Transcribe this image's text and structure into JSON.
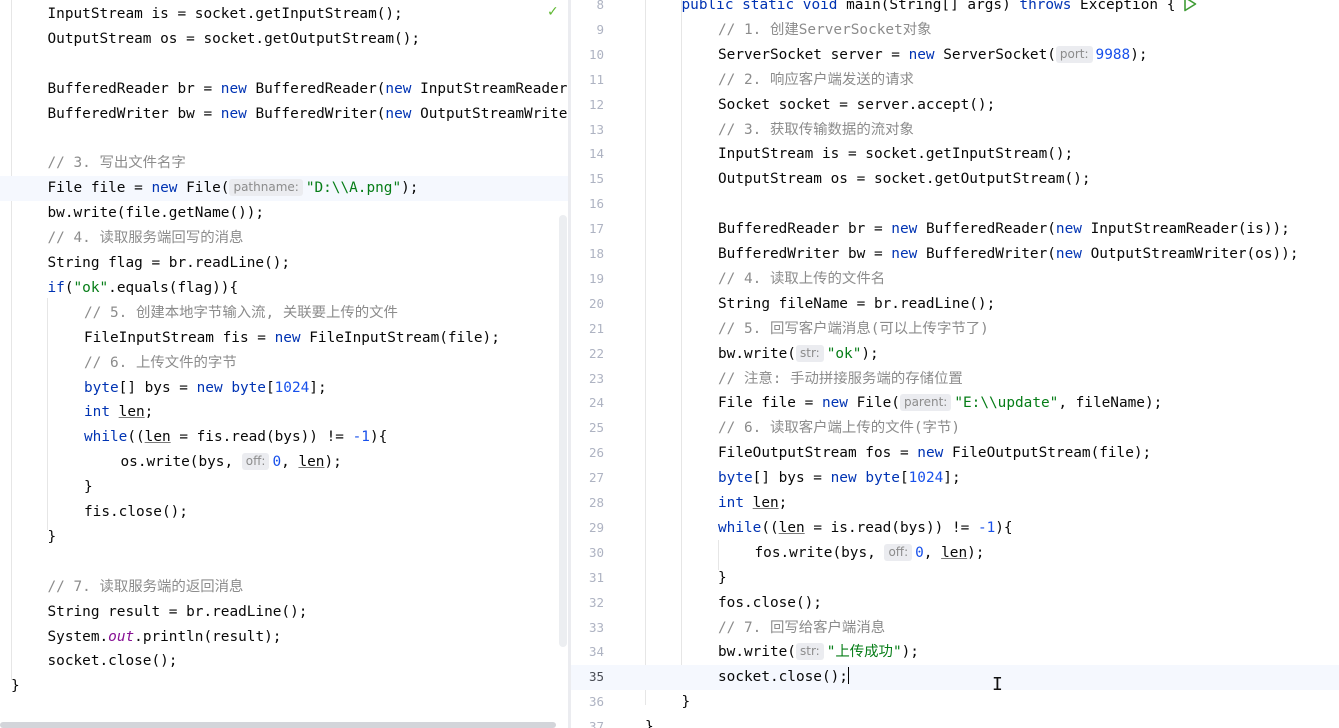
{
  "left_lines": [
    {
      "row": 0,
      "indent": 1,
      "current": false,
      "tokens": [
        {
          "t": "InputStream is = socket.getInputStream();"
        }
      ]
    },
    {
      "row": 1,
      "indent": 1,
      "current": false,
      "tokens": [
        {
          "t": "OutputStream os = socket.getOutputStream();"
        }
      ]
    },
    {
      "row": 3,
      "indent": 1,
      "current": false,
      "tokens": [
        {
          "t": "BufferedReader br = "
        },
        {
          "t": "new",
          "c": "kw"
        },
        {
          "t": " BufferedReader("
        },
        {
          "t": "new",
          "c": "kw"
        },
        {
          "t": " InputStreamReader(is));"
        }
      ]
    },
    {
      "row": 4,
      "indent": 1,
      "current": false,
      "tokens": [
        {
          "t": "BufferedWriter bw = "
        },
        {
          "t": "new",
          "c": "kw"
        },
        {
          "t": " BufferedWriter("
        },
        {
          "t": "new",
          "c": "kw"
        },
        {
          "t": " OutputStreamWriter(os));"
        }
      ]
    },
    {
      "row": 6,
      "indent": 1,
      "current": false,
      "tokens": [
        {
          "t": "// 3. 写出文件名字",
          "c": "cmt"
        }
      ]
    },
    {
      "row": 7,
      "indent": 1,
      "current": true,
      "tokens": [
        {
          "t": "File file = "
        },
        {
          "t": "new",
          "c": "kw"
        },
        {
          "t": " File("
        },
        {
          "t": "pathname:",
          "c": "hint"
        },
        {
          "t": "\"D:\\\\A.png\"",
          "c": "str"
        },
        {
          "t": ");"
        }
      ]
    },
    {
      "row": 8,
      "indent": 1,
      "current": false,
      "tokens": [
        {
          "t": "bw.write(file.getName());"
        }
      ]
    },
    {
      "row": 9,
      "indent": 1,
      "current": false,
      "tokens": [
        {
          "t": "// 4. 读取服务端回写的消息",
          "c": "cmt"
        }
      ]
    },
    {
      "row": 10,
      "indent": 1,
      "current": false,
      "tokens": [
        {
          "t": "String flag = br.readLine();"
        }
      ]
    },
    {
      "row": 11,
      "indent": 1,
      "current": false,
      "tokens": [
        {
          "t": "if",
          "c": "kw"
        },
        {
          "t": "("
        },
        {
          "t": "\"ok\"",
          "c": "str"
        },
        {
          "t": ".equals(flag)){"
        }
      ]
    },
    {
      "row": 12,
      "indent": 2,
      "current": false,
      "tokens": [
        {
          "t": "// 5. 创建本地字节输入流, 关联要上传的文件",
          "c": "cmt"
        }
      ]
    },
    {
      "row": 13,
      "indent": 2,
      "current": false,
      "tokens": [
        {
          "t": "FileInputStream fis = "
        },
        {
          "t": "new",
          "c": "kw"
        },
        {
          "t": " FileInputStream(file);"
        }
      ]
    },
    {
      "row": 14,
      "indent": 2,
      "current": false,
      "tokens": [
        {
          "t": "// 6. 上传文件的字节",
          "c": "cmt"
        }
      ]
    },
    {
      "row": 15,
      "indent": 2,
      "current": false,
      "tokens": [
        {
          "t": "byte",
          "c": "kw"
        },
        {
          "t": "[] bys = "
        },
        {
          "t": "new",
          "c": "kw"
        },
        {
          "t": " "
        },
        {
          "t": "byte",
          "c": "kw"
        },
        {
          "t": "["
        },
        {
          "t": "1024",
          "c": "num"
        },
        {
          "t": "];"
        }
      ]
    },
    {
      "row": 16,
      "indent": 2,
      "current": false,
      "tokens": [
        {
          "t": "int",
          "c": "kw"
        },
        {
          "t": " "
        },
        {
          "t": "len",
          "c": "ul"
        },
        {
          "t": ";"
        }
      ]
    },
    {
      "row": 17,
      "indent": 2,
      "current": false,
      "tokens": [
        {
          "t": "while",
          "c": "kw"
        },
        {
          "t": "(("
        },
        {
          "t": "len",
          "c": "ul"
        },
        {
          "t": " = fis.read(bys)) != "
        },
        {
          "t": "-1",
          "c": "num"
        },
        {
          "t": "){"
        }
      ]
    },
    {
      "row": 18,
      "indent": 3,
      "current": false,
      "tokens": [
        {
          "t": "os.write(bys, "
        },
        {
          "t": "off:",
          "c": "hint"
        },
        {
          "t": "0",
          "c": "num"
        },
        {
          "t": ", "
        },
        {
          "t": "len",
          "c": "ul"
        },
        {
          "t": ");"
        }
      ]
    },
    {
      "row": 19,
      "indent": 2,
      "current": false,
      "tokens": [
        {
          "t": "}"
        }
      ]
    },
    {
      "row": 20,
      "indent": 2,
      "current": false,
      "tokens": [
        {
          "t": "fis.close();"
        }
      ]
    },
    {
      "row": 21,
      "indent": 1,
      "current": false,
      "tokens": [
        {
          "t": "}"
        }
      ]
    },
    {
      "row": 23,
      "indent": 1,
      "current": false,
      "tokens": [
        {
          "t": "// 7. 读取服务端的返回消息",
          "c": "cmt"
        }
      ]
    },
    {
      "row": 24,
      "indent": 1,
      "current": false,
      "tokens": [
        {
          "t": "String result = br.readLine();"
        }
      ]
    },
    {
      "row": 25,
      "indent": 1,
      "current": false,
      "tokens": [
        {
          "t": "System."
        },
        {
          "t": "out",
          "c": "st"
        },
        {
          "t": ".println(result);"
        }
      ]
    },
    {
      "row": 26,
      "indent": 1,
      "current": false,
      "tokens": [
        {
          "t": "socket.close();"
        }
      ]
    },
    {
      "row": 27,
      "indent": 0,
      "current": false,
      "tokens": [
        {
          "t": "}"
        }
      ]
    }
  ],
  "right_lines": [
    {
      "n": "8",
      "indent": 1,
      "current": false,
      "tokens": [
        {
          "t": "public static void",
          "c": "kw"
        },
        {
          "t": " main(String[] args) "
        },
        {
          "t": "throws",
          "c": "kw"
        },
        {
          "t": " Exception {"
        }
      ]
    },
    {
      "n": "9",
      "indent": 2,
      "current": false,
      "tokens": [
        {
          "t": "// 1. 创建ServerSocket对象",
          "c": "cmt"
        }
      ]
    },
    {
      "n": "10",
      "indent": 2,
      "current": false,
      "tokens": [
        {
          "t": "ServerSocket server = "
        },
        {
          "t": "new",
          "c": "kw"
        },
        {
          "t": " ServerSocket("
        },
        {
          "t": "port:",
          "c": "hint"
        },
        {
          "t": "9988",
          "c": "num"
        },
        {
          "t": ");"
        }
      ]
    },
    {
      "n": "11",
      "indent": 2,
      "current": false,
      "tokens": [
        {
          "t": "// 2. 响应客户端发送的请求",
          "c": "cmt"
        }
      ]
    },
    {
      "n": "12",
      "indent": 2,
      "current": false,
      "tokens": [
        {
          "t": "Socket socket = server.accept();"
        }
      ]
    },
    {
      "n": "13",
      "indent": 2,
      "current": false,
      "tokens": [
        {
          "t": "// 3. 获取传输数据的流对象",
          "c": "cmt"
        }
      ]
    },
    {
      "n": "14",
      "indent": 2,
      "current": false,
      "tokens": [
        {
          "t": "InputStream is = socket.getInputStream();"
        }
      ]
    },
    {
      "n": "15",
      "indent": 2,
      "current": false,
      "tokens": [
        {
          "t": "OutputStream os = socket.getOutputStream();"
        }
      ]
    },
    {
      "n": "16",
      "indent": 2,
      "current": false,
      "tokens": []
    },
    {
      "n": "17",
      "indent": 2,
      "current": false,
      "tokens": [
        {
          "t": "BufferedReader br = "
        },
        {
          "t": "new",
          "c": "kw"
        },
        {
          "t": " BufferedReader("
        },
        {
          "t": "new",
          "c": "kw"
        },
        {
          "t": " InputStreamReader(is));"
        }
      ]
    },
    {
      "n": "18",
      "indent": 2,
      "current": false,
      "tokens": [
        {
          "t": "BufferedWriter bw = "
        },
        {
          "t": "new",
          "c": "kw"
        },
        {
          "t": " BufferedWriter("
        },
        {
          "t": "new",
          "c": "kw"
        },
        {
          "t": " OutputStreamWriter(os));"
        }
      ]
    },
    {
      "n": "19",
      "indent": 2,
      "current": false,
      "tokens": [
        {
          "t": "// 4. 读取上传的文件名",
          "c": "cmt"
        }
      ]
    },
    {
      "n": "20",
      "indent": 2,
      "current": false,
      "tokens": [
        {
          "t": "String fileName = br.readLine();"
        }
      ]
    },
    {
      "n": "21",
      "indent": 2,
      "current": false,
      "tokens": [
        {
          "t": "// 5. 回写客户端消息(可以上传字节了)",
          "c": "cmt"
        }
      ]
    },
    {
      "n": "22",
      "indent": 2,
      "current": false,
      "tokens": [
        {
          "t": "bw.write("
        },
        {
          "t": "str:",
          "c": "hint"
        },
        {
          "t": "\"ok\"",
          "c": "str"
        },
        {
          "t": ");"
        }
      ]
    },
    {
      "n": "23",
      "indent": 2,
      "current": false,
      "tokens": [
        {
          "t": "// 注意: 手动拼接服务端的存储位置",
          "c": "cmt"
        }
      ]
    },
    {
      "n": "24",
      "indent": 2,
      "current": false,
      "tokens": [
        {
          "t": "File file = "
        },
        {
          "t": "new",
          "c": "kw"
        },
        {
          "t": " File("
        },
        {
          "t": "parent:",
          "c": "hint"
        },
        {
          "t": "\"E:\\\\update\"",
          "c": "str"
        },
        {
          "t": ", fileName);"
        }
      ]
    },
    {
      "n": "25",
      "indent": 2,
      "current": false,
      "tokens": [
        {
          "t": "// 6. 读取客户端上传的文件(字节)",
          "c": "cmt"
        }
      ]
    },
    {
      "n": "26",
      "indent": 2,
      "current": false,
      "tokens": [
        {
          "t": "FileOutputStream fos = "
        },
        {
          "t": "new",
          "c": "kw"
        },
        {
          "t": " FileOutputStream(file);"
        }
      ]
    },
    {
      "n": "27",
      "indent": 2,
      "current": false,
      "tokens": [
        {
          "t": "byte",
          "c": "kw"
        },
        {
          "t": "[] bys = "
        },
        {
          "t": "new",
          "c": "kw"
        },
        {
          "t": " "
        },
        {
          "t": "byte",
          "c": "kw"
        },
        {
          "t": "["
        },
        {
          "t": "1024",
          "c": "num"
        },
        {
          "t": "];"
        }
      ]
    },
    {
      "n": "28",
      "indent": 2,
      "current": false,
      "tokens": [
        {
          "t": "int",
          "c": "kw"
        },
        {
          "t": " "
        },
        {
          "t": "len",
          "c": "ul"
        },
        {
          "t": ";"
        }
      ]
    },
    {
      "n": "29",
      "indent": 2,
      "current": false,
      "tokens": [
        {
          "t": "while",
          "c": "kw"
        },
        {
          "t": "(("
        },
        {
          "t": "len",
          "c": "ul"
        },
        {
          "t": " = is.read(bys)) != "
        },
        {
          "t": "-1",
          "c": "num"
        },
        {
          "t": "){"
        }
      ]
    },
    {
      "n": "30",
      "indent": 3,
      "current": false,
      "tokens": [
        {
          "t": "fos.write(bys, "
        },
        {
          "t": "off:",
          "c": "hint"
        },
        {
          "t": "0",
          "c": "num"
        },
        {
          "t": ", "
        },
        {
          "t": "len",
          "c": "ul"
        },
        {
          "t": ");"
        }
      ]
    },
    {
      "n": "31",
      "indent": 2,
      "current": false,
      "tokens": [
        {
          "t": "}"
        }
      ]
    },
    {
      "n": "32",
      "indent": 2,
      "current": false,
      "tokens": [
        {
          "t": "fos.close();"
        }
      ]
    },
    {
      "n": "33",
      "indent": 2,
      "current": false,
      "tokens": [
        {
          "t": "// 7. 回写给客户端消息",
          "c": "cmt"
        }
      ]
    },
    {
      "n": "34",
      "indent": 2,
      "current": false,
      "tokens": [
        {
          "t": "bw.write("
        },
        {
          "t": "str:",
          "c": "hint"
        },
        {
          "t": "\"上传成功\"",
          "c": "str"
        },
        {
          "t": ");"
        }
      ]
    },
    {
      "n": "35",
      "indent": 2,
      "current": true,
      "caret": true,
      "tokens": [
        {
          "t": "socket.close();"
        }
      ]
    },
    {
      "n": "36",
      "indent": 1,
      "current": false,
      "tokens": [
        {
          "t": "}"
        }
      ]
    },
    {
      "n": "37",
      "indent": 0,
      "current": false,
      "tokens": [
        {
          "t": "}"
        }
      ]
    }
  ],
  "icons": {
    "check": "check-icon",
    "run": "run-gutter-icon",
    "cursor": "text-cursor-icon"
  }
}
